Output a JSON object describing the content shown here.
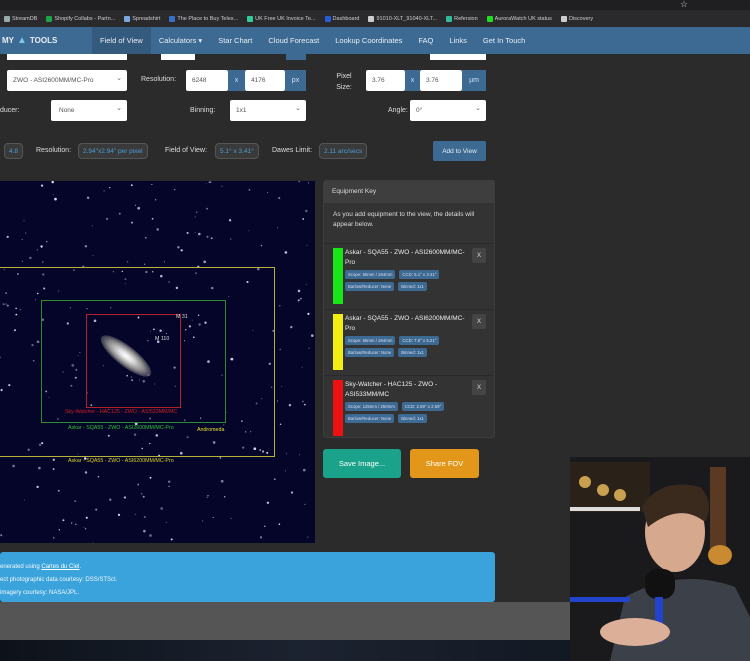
{
  "browser": {
    "bookmarks": [
      "StreamDB",
      "Shopify Collabs - Partn...",
      "Spreadshirt",
      "The Place to Buy Teles...",
      "UK Free UK Invoice Te...",
      "Dashboard",
      "91010-XLT_91040-XLT...",
      "Refersion",
      "AuroraWatch UK status",
      "Discovery"
    ],
    "bookmark_colors": [
      "#9aa",
      "#1fa34a",
      "#7aa7e0",
      "#3a6fc8",
      "#3c9",
      "#2a5bd7",
      "#ccc",
      "#3b9",
      "#2d2",
      "#ccc"
    ]
  },
  "nav": {
    "brand": "MY TOOLS",
    "brand_left": "MY",
    "brand_right": "TOOLS",
    "items": [
      "Field of View",
      "Calculators ▾",
      "Star Chart",
      "Cloud Forecast",
      "Lookup Coordinates",
      "FAQ",
      "Links",
      "Get In Touch"
    ]
  },
  "form": {
    "camera": "ZWO - ASI2600MM/MC-Pro",
    "resolution_label": "Resolution:",
    "res_w": "6248",
    "res_h": "4176",
    "x": "x",
    "px": "px",
    "pixel_size_label": "Pixel Size:",
    "pix_w": "3.76",
    "pix_h": "3.76",
    "um": "µm",
    "reducer_label": "ducer:",
    "reducer": "None",
    "binning_label": "Binning:",
    "binning": "1x1",
    "angle_label": "Angle:",
    "angle": "0°"
  },
  "results": {
    "ratio": "4.8",
    "resolution_label": "Resolution:",
    "resolution": "2.94\"x2.94\" per pixel",
    "fov_label": "Field of View:",
    "fov": "5.1° x 3.41°",
    "dawes_label": "Dawes Limit:",
    "dawes": "2.11 arc/secs",
    "add_button": "Add to View"
  },
  "map": {
    "labels": {
      "m31": "M 31",
      "m110": "M 110",
      "andromeda": "Andromeda",
      "red": "Sky-Watcher - HAC125 - ZWO - ASI533MM/MC",
      "green": "Askar - SQA55 - ZWO - ASI2600MM/MC-Pro",
      "yellow": "Askar - SQA55 - ZWO - ASI6200MM/MC-Pro"
    }
  },
  "equipment_key": {
    "title": "Equipment Key",
    "intro": "As you add equipment to the view, the details will appear below.",
    "remove": "X",
    "items": [
      {
        "name": "Askar - SQA55 - ZWO - ASI2600MM/MC-Pro",
        "color": "#19e619",
        "scope": "Scope: 55mm / 264mm",
        "ccd": "CCD: 5.1° x 3.41°",
        "reducer": "Barlow/Reducer: None",
        "binned": "Binned: 1x1"
      },
      {
        "name": "Askar - SQA55 - ZWO - ASI6200MM/MC-Pro",
        "color": "#f2ee12",
        "scope": "Scope: 55mm / 264mm",
        "ccd": "CCD: 7.8° x 5.21°",
        "reducer": "Barlow/Reducer: None",
        "binned": "Binned: 1x1"
      },
      {
        "name": "Sky-Watcher - HAC125 - ZWO - ASI533MM/MC",
        "color": "#ee1111",
        "scope": "Scope: 125mm / 250mm",
        "ccd": "CCD: 2.59° x 2.59°",
        "reducer": "Barlow/Reducer: None",
        "binned": "Binned: 1x1"
      }
    ]
  },
  "actions": {
    "save": "Save Image...",
    "share": "Share FOV"
  },
  "info": {
    "line1_prefix": "enerated using ",
    "line1_link": "Cartes du Ciel",
    "line1_suffix": ".",
    "line2": "ect photographic data courtesy: DSS/STScI.",
    "line3": " imagery courtesy: NASA/JPL."
  }
}
